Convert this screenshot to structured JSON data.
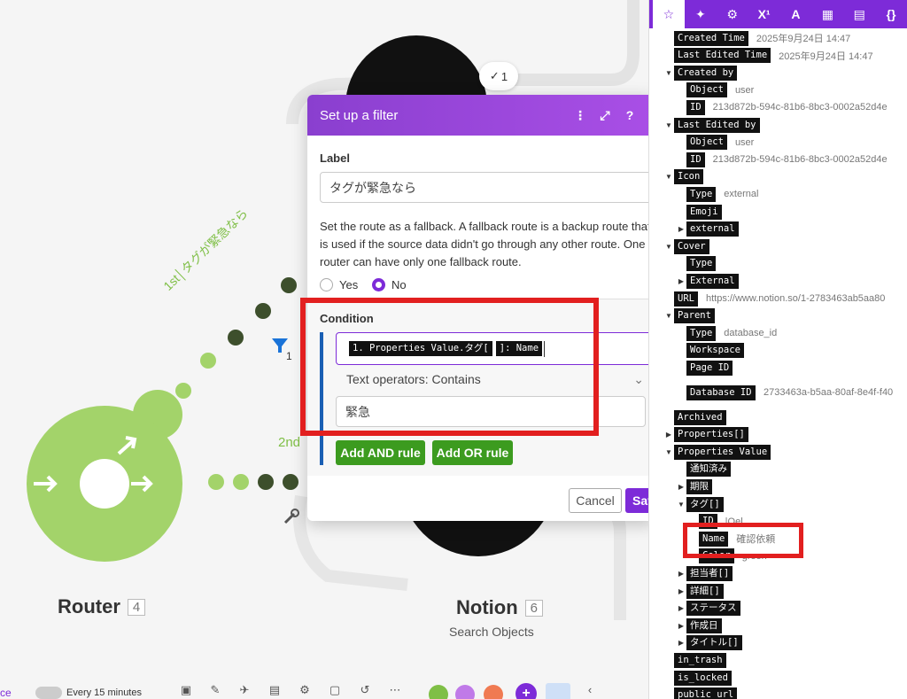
{
  "canvas": {
    "edge_badge": "1",
    "route_first_label": "1st│タグが緊急なら",
    "route_second_label": "2nd",
    "filter_count": "1",
    "router": {
      "name": "Router",
      "id": "4"
    },
    "notion": {
      "name": "Notion",
      "id": "6",
      "subtitle": "Search Objects"
    }
  },
  "modal": {
    "title": "Set up a filter",
    "label_title": "Label",
    "label_value": "タグが緊急なら",
    "fallback_text": "Set the route as a fallback. A fallback route is a backup route that is used if the source data didn't go through any other route. One router can have only one fallback route.",
    "yes_label": "Yes",
    "no_label": "No",
    "condition_title": "Condition",
    "condition_token1": "1. Properties Value.タグ[",
    "condition_token2": "]: Name",
    "operator": "Text operators: Contains",
    "value": "緊急",
    "add_and": "Add AND rule",
    "add_or": "Add OR rule",
    "cancel": "Cancel",
    "save": "Save"
  },
  "toolbar": {
    "left_text": "ce",
    "schedule": "Every 15 minutes"
  },
  "panel": {
    "tabs": [
      "☆",
      "✦",
      "⚙",
      "X¹",
      "A",
      "▦",
      "▤",
      "{}"
    ],
    "rows": [
      {
        "arrow": "",
        "key": "Created Time",
        "val": "2025年9月24日 14:47",
        "indent": 0
      },
      {
        "arrow": "",
        "key": "Last Edited Time",
        "val": "2025年9月24日 14:47",
        "indent": 0
      },
      {
        "arrow": "▼",
        "key": "Created by",
        "val": "",
        "indent": 0
      },
      {
        "arrow": "",
        "key": "Object",
        "val": "user",
        "indent": 1
      },
      {
        "arrow": "",
        "key": "ID",
        "val": "213d872b-594c-81b6-8bc3-0002a52d4e",
        "indent": 1
      },
      {
        "arrow": "▼",
        "key": "Last Edited by",
        "val": "",
        "indent": 0
      },
      {
        "arrow": "",
        "key": "Object",
        "val": "user",
        "indent": 1
      },
      {
        "arrow": "",
        "key": "ID",
        "val": "213d872b-594c-81b6-8bc3-0002a52d4e",
        "indent": 1
      },
      {
        "arrow": "▼",
        "key": "Icon",
        "val": "",
        "indent": 0
      },
      {
        "arrow": "",
        "key": "Type",
        "val": "external",
        "indent": 1
      },
      {
        "arrow": "",
        "key": "Emoji",
        "val": "",
        "indent": 1
      },
      {
        "arrow": "▶",
        "key": "external",
        "val": "",
        "indent": 1
      },
      {
        "arrow": "▼",
        "key": "Cover",
        "val": "",
        "indent": 0
      },
      {
        "arrow": "",
        "key": "Type",
        "val": "",
        "indent": 1
      },
      {
        "arrow": "▶",
        "key": "External",
        "val": "",
        "indent": 1
      },
      {
        "arrow": "",
        "key": "URL",
        "val": "https://www.notion.so/1-2783463ab5aa80",
        "indent": 0
      },
      {
        "arrow": "▼",
        "key": "Parent",
        "val": "",
        "indent": 0
      },
      {
        "arrow": "",
        "key": "Type",
        "val": "database_id",
        "indent": 1
      },
      {
        "arrow": "",
        "key": "Workspace",
        "val": "",
        "indent": 1
      },
      {
        "arrow": "",
        "key": "Page ID",
        "val": "",
        "indent": 1
      },
      {
        "arrow": "",
        "key": "Database ID",
        "val": "2733463a-b5aa-80af-8e4f-f40",
        "indent": 1,
        "tall": true
      },
      {
        "arrow": "",
        "key": "Archived",
        "val": "",
        "indent": 0
      },
      {
        "arrow": "▶",
        "key": "Properties[]",
        "val": "",
        "indent": 0
      },
      {
        "arrow": "▼",
        "key": "Properties Value",
        "val": "",
        "indent": 0
      },
      {
        "arrow": "",
        "key": "通知済み",
        "val": "",
        "indent": 1
      },
      {
        "arrow": "▶",
        "key": "期限",
        "val": "",
        "indent": 1
      },
      {
        "arrow": "▼",
        "key": "タグ[]",
        "val": "",
        "indent": 1
      },
      {
        "arrow": "",
        "key": "ID",
        "val": "|Oel",
        "indent": 2
      },
      {
        "arrow": "",
        "key": "Name",
        "val": "確認依頼",
        "indent": 2
      },
      {
        "arrow": "",
        "key": "Color",
        "val": "green",
        "indent": 2
      },
      {
        "arrow": "▶",
        "key": "担当者[]",
        "val": "",
        "indent": 1
      },
      {
        "arrow": "▶",
        "key": "詳細[]",
        "val": "",
        "indent": 1
      },
      {
        "arrow": "▶",
        "key": "ステータス",
        "val": "",
        "indent": 1
      },
      {
        "arrow": "▶",
        "key": "作成日",
        "val": "",
        "indent": 1
      },
      {
        "arrow": "▶",
        "key": "タイトル[]",
        "val": "",
        "indent": 1
      },
      {
        "arrow": "",
        "key": "in_trash",
        "val": "",
        "indent": 0
      },
      {
        "arrow": "",
        "key": "is_locked",
        "val": "",
        "indent": 0
      },
      {
        "arrow": "",
        "key": "public_url",
        "val": "",
        "indent": 0
      }
    ]
  },
  "colors": {
    "purple": "#7d2bd8",
    "green": "#3c9b1f",
    "router_green": "#a3d36a",
    "highlight_red": "#e21f1f"
  }
}
